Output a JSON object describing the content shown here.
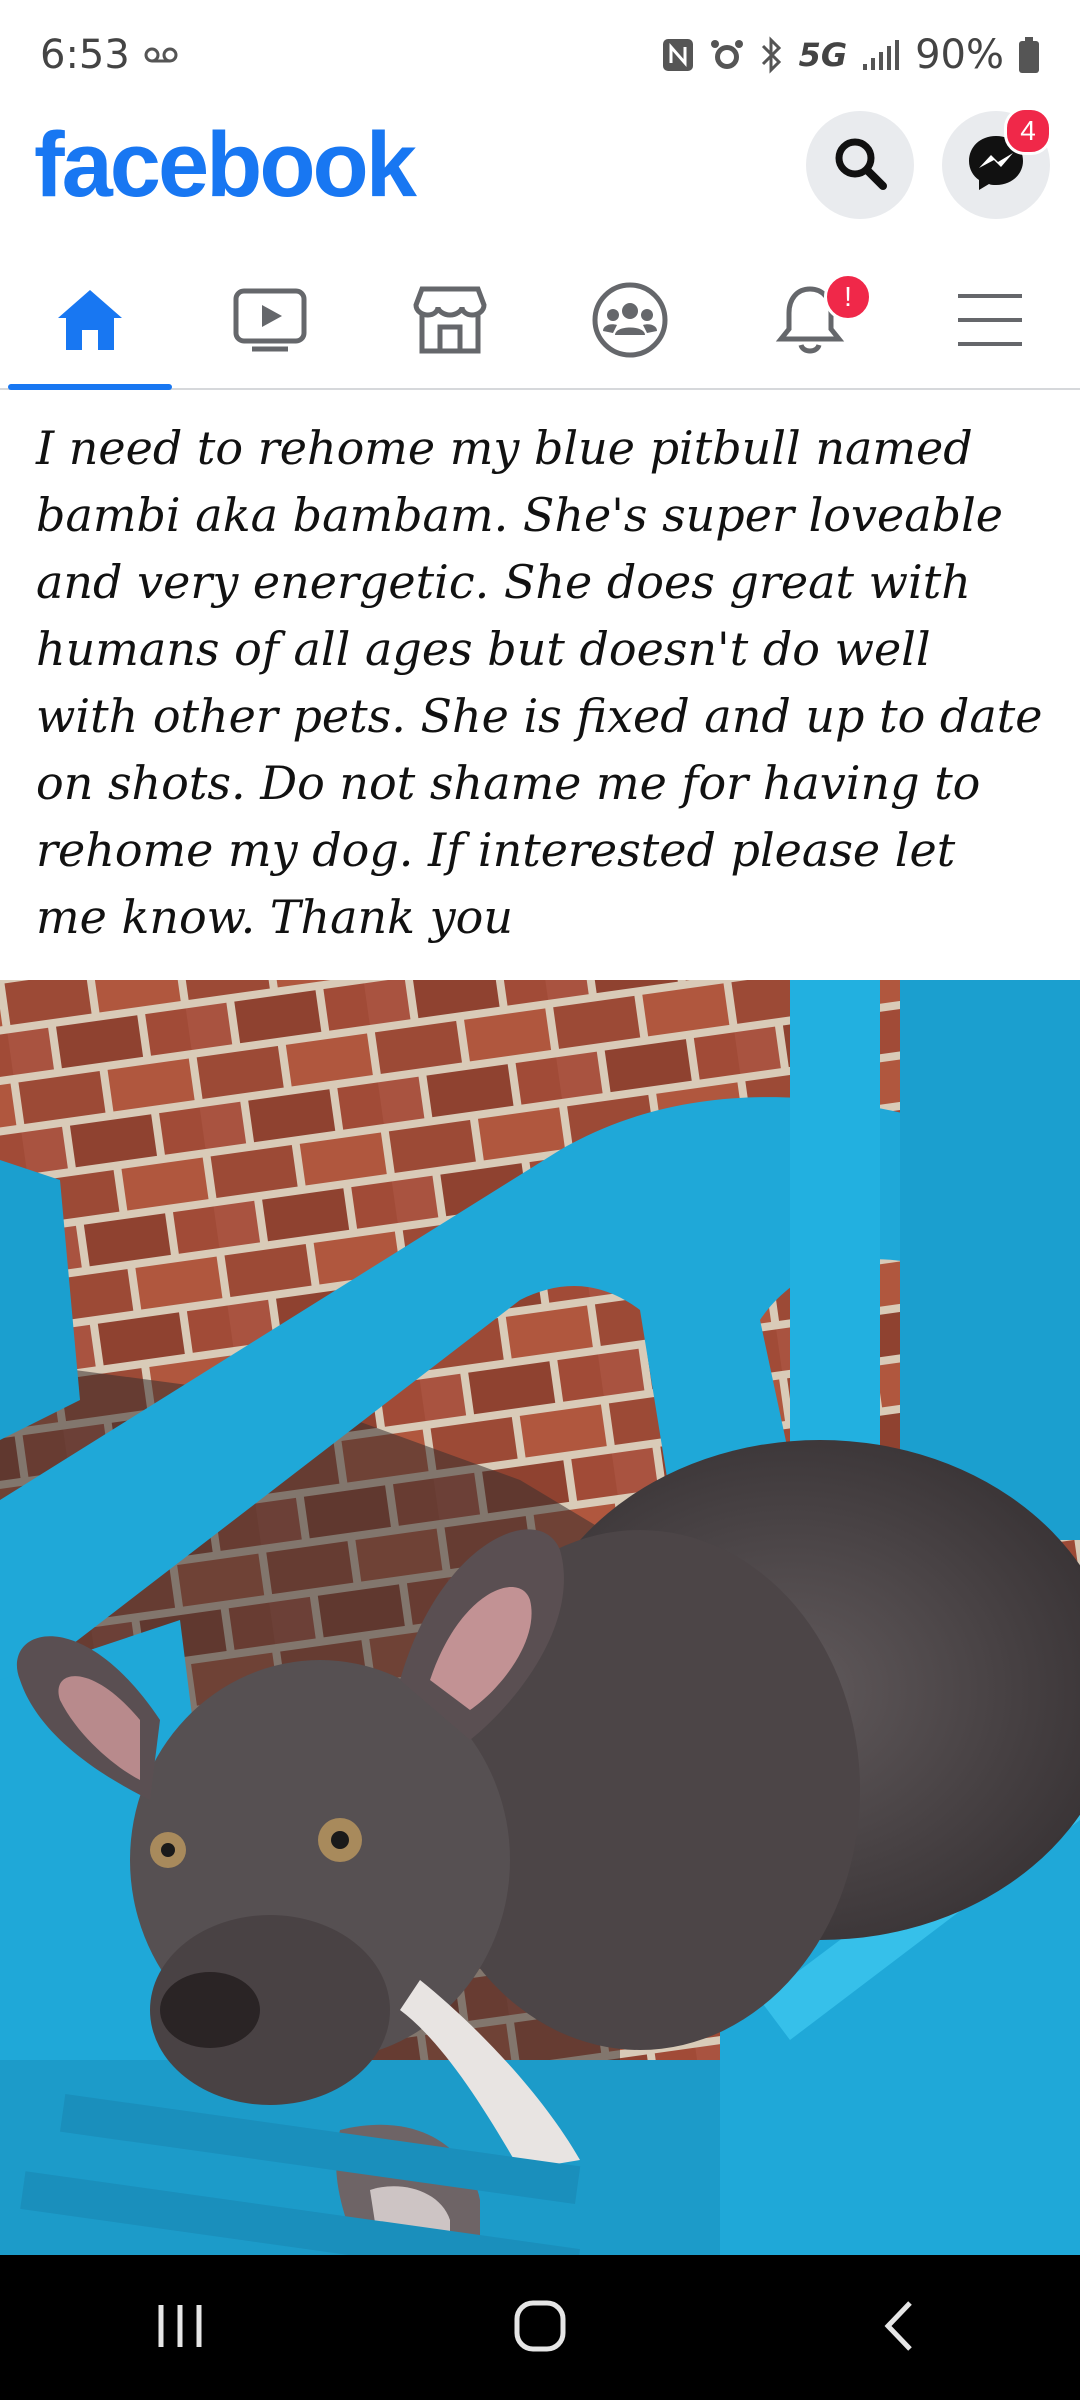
{
  "status_bar": {
    "time": "6:53",
    "network": "5G",
    "battery": "90%"
  },
  "header": {
    "brand": "facebook",
    "messenger_badge": "4"
  },
  "nav": {
    "tabs": [
      {
        "name": "home",
        "icon": "home-icon",
        "active": true
      },
      {
        "name": "watch",
        "icon": "video-icon",
        "active": false
      },
      {
        "name": "marketplace",
        "icon": "marketplace-icon",
        "active": false
      },
      {
        "name": "groups",
        "icon": "groups-icon",
        "active": false
      },
      {
        "name": "notifications",
        "icon": "bell-icon",
        "active": false,
        "badge": "!"
      },
      {
        "name": "menu",
        "icon": "menu-icon",
        "active": false
      }
    ]
  },
  "post": {
    "lines": [
      "I need to rehome my blue pitbull named",
      "bambi aka bambam. She's super loveable",
      "and very energetic. She does great with",
      "humans of all ages but doesn't do well",
      "with other pets. She is fixed and up to date",
      "on shots. Do not shame me for having to",
      "rehome my dog. If interested please let",
      "me know. Thank you"
    ]
  },
  "colors": {
    "brand": "#1877f2",
    "badge": "#f02849",
    "chair": "#1fa8d8"
  }
}
